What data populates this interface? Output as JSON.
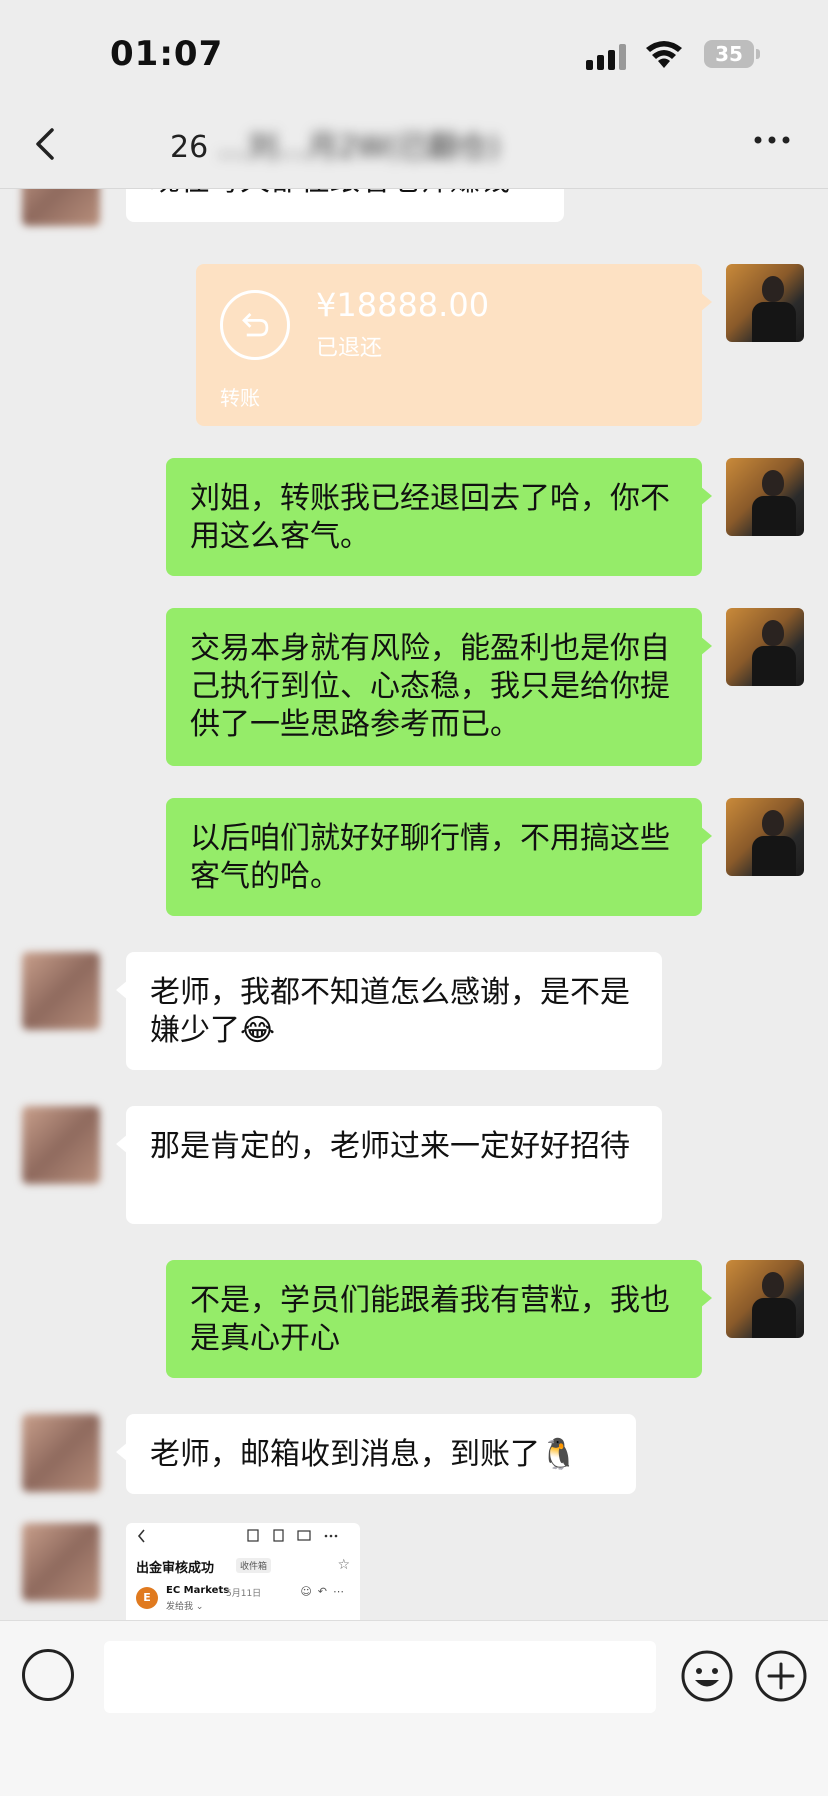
{
  "status": {
    "time": "01:07",
    "battery": "35"
  },
  "header": {
    "title_visible": "26",
    "title_obscured": "…刘…月2W(已翻仓)"
  },
  "messages": [
    {
      "id": "m0",
      "side": "in",
      "text": "现在每天都在跟着老师赚钱"
    },
    {
      "id": "m1",
      "side": "out",
      "type": "transfer",
      "amount": "¥18888.00",
      "status": "已退还",
      "label": "转账"
    },
    {
      "id": "m2",
      "side": "out",
      "text": "刘姐，转账我已经退回去了哈，你不用这么客气。"
    },
    {
      "id": "m3",
      "side": "out",
      "text": "交易本身就有风险，能盈利也是你自己执行到位、心态稳，我只是给你提供了一些思路参考而已。"
    },
    {
      "id": "m4",
      "side": "out",
      "text": "以后咱们就好好聊行情，不用搞这些客气的哈。"
    },
    {
      "id": "m5",
      "side": "in",
      "text": "老师，我都不知道怎么感谢，是不是嫌少了😂"
    },
    {
      "id": "m6",
      "side": "in",
      "text": "那是肯定的，老师过来一定好好招待"
    },
    {
      "id": "m7",
      "side": "out",
      "text": "不是，学员们能跟着我有营粒，我也是真心开心"
    },
    {
      "id": "m8",
      "side": "in",
      "text": "老师，邮箱收到消息，到账了🐧"
    },
    {
      "id": "m9",
      "side": "in",
      "type": "image",
      "email": {
        "subject": "出金审核成功",
        "tag": "收件箱",
        "sender": "EC Markets",
        "date": "5月11日",
        "to": "发给我 ⌄",
        "logo_letter": "E"
      }
    }
  ],
  "icons": {
    "back": "chevron-left-icon",
    "more": "ellipsis-icon",
    "voice": "voice-icon",
    "emoji": "emoji-icon",
    "plus": "plus-icon"
  },
  "colors": {
    "outgoing": "#95ec69",
    "incoming": "#ffffff",
    "transfer": "#fde1c3",
    "background": "#ededed"
  }
}
